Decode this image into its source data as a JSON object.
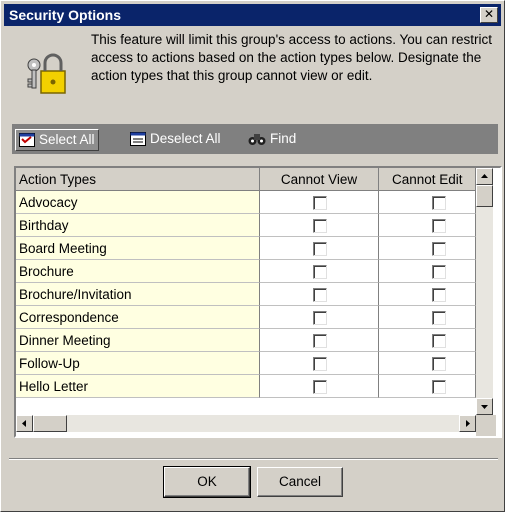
{
  "window": {
    "title": "Security Options",
    "close_glyph": "✕"
  },
  "info": {
    "icon": "keys-padlock-icon",
    "text": "This feature will limit this group's access to actions.  You can restrict access to actions based on the action types below. Designate the action types that this group cannot view or edit."
  },
  "toolbar": {
    "select_all": "Select All",
    "deselect_all": "Deselect All",
    "find": "Find"
  },
  "grid": {
    "columns": [
      "Action Types",
      "Cannot View",
      "Cannot Edit"
    ],
    "rows": [
      {
        "name": "Advocacy",
        "cannot_view": false,
        "cannot_edit": false
      },
      {
        "name": "Birthday",
        "cannot_view": false,
        "cannot_edit": false
      },
      {
        "name": "Board Meeting",
        "cannot_view": false,
        "cannot_edit": false
      },
      {
        "name": "Brochure",
        "cannot_view": false,
        "cannot_edit": false
      },
      {
        "name": "Brochure/Invitation",
        "cannot_view": false,
        "cannot_edit": false
      },
      {
        "name": "Correspondence",
        "cannot_view": false,
        "cannot_edit": false
      },
      {
        "name": "Dinner Meeting",
        "cannot_view": false,
        "cannot_edit": false
      },
      {
        "name": "Follow-Up",
        "cannot_view": false,
        "cannot_edit": false
      },
      {
        "name": "Hello Letter",
        "cannot_view": false,
        "cannot_edit": false
      }
    ]
  },
  "buttons": {
    "ok": "OK",
    "cancel": "Cancel"
  }
}
